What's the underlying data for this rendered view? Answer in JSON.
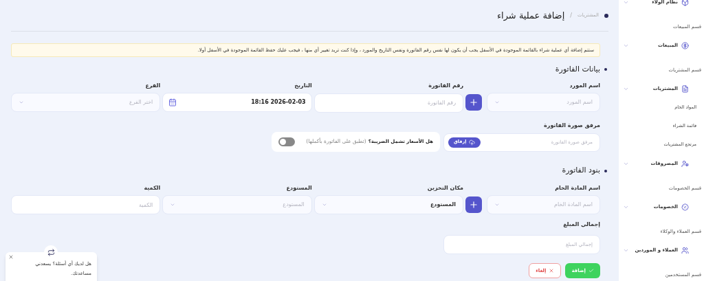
{
  "breadcrumb": {
    "parent": "المشتريات",
    "separator": "/",
    "current": "إضافة عملية شراء"
  },
  "alert": "ستتم إضافة أي عملية شراء بالقائمة الموجودة في الأسفل يجب أن يكون لها نفس رقم الفاتورة ونفس التاريخ والمورد ، وإذا كنت تريد تغيير أي منها ، فيجب عليك حفظ القائمة الموجودة في الأسفل أولا.",
  "invoice_section": {
    "title": "بيانات الفاتورة",
    "fields": [
      {
        "kind": "select_add",
        "label": "اسم المورد",
        "placeholder": "اسم المورد"
      },
      {
        "kind": "text",
        "label": "رقم الفاتورة",
        "placeholder": "رقم الفاتورة"
      },
      {
        "kind": "date",
        "label": "التاريخ",
        "value": "18:16 2026-02-03"
      },
      {
        "kind": "select",
        "label": "الفرع",
        "placeholder": "اختر الفرع"
      }
    ],
    "attachment": {
      "label": "مرفق صورة الفاتورة",
      "placeholder": "مرفق صورة الفاتورة",
      "button": "إرفاق"
    },
    "tax_toggle": {
      "question": "هل الأسعار تشمل الضريبة؟",
      "note": "(تطبق على الفاتورة بأكملها)",
      "on": false
    }
  },
  "items_section": {
    "title": "بنود الفاتورة",
    "fields": [
      {
        "kind": "select_add",
        "label": "اسم المادة الخام",
        "placeholder": "اسم المادة الخام"
      },
      {
        "kind": "select",
        "label": "مكان التخزين",
        "value": "المستودع"
      },
      {
        "kind": "select",
        "label": "المستودع",
        "placeholder": "المستودع"
      },
      {
        "kind": "text",
        "label": "الكمية",
        "placeholder": "الكمية"
      }
    ],
    "total": {
      "label": "إجمالي المبلغ",
      "placeholder": "إجمالي المبلغ"
    }
  },
  "buttons": [
    {
      "kind": "submit",
      "label": "إضافة"
    },
    {
      "kind": "cancel",
      "label": "إلغاء"
    }
  ],
  "chat": {
    "message": "هل لديك أي أسئلة؟ يسعدني مساعدتك."
  },
  "sidebar": {
    "items": [
      {
        "kind": "group",
        "label": "نظام الولاء"
      },
      {
        "kind": "section",
        "label": "قسم المبيعات"
      },
      {
        "kind": "group",
        "label": "المبيعات"
      },
      {
        "kind": "section",
        "label": "قسم المشتريات"
      },
      {
        "kind": "group",
        "label": "المشتريات",
        "children": [
          {
            "label": "المواد الخام"
          },
          {
            "label": "قائمة الشراء"
          },
          {
            "label": "مرتجع المشتريات"
          }
        ]
      },
      {
        "kind": "group",
        "label": "المصروفات"
      },
      {
        "kind": "section",
        "label": "قسم الخصومات"
      },
      {
        "kind": "group",
        "label": "الخصومات"
      },
      {
        "kind": "section",
        "label": "قسم العملاء والوكلاء"
      },
      {
        "kind": "group",
        "label": "العملاء و الموردين"
      },
      {
        "kind": "section",
        "label": "قسم المستخدمين"
      }
    ]
  }
}
